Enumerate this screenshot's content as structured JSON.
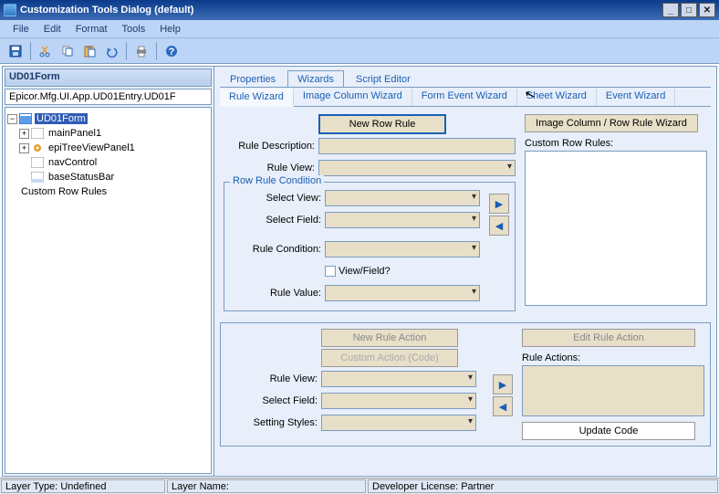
{
  "title": "Customization Tools Dialog (default)",
  "menu": {
    "file": "File",
    "edit": "Edit",
    "format": "Format",
    "tools": "Tools",
    "help": "Help"
  },
  "form_header": "UD01Form",
  "path": "Epicor.Mfg.UI.App.UD01Entry.UD01F",
  "tree": {
    "root": "UD01Form",
    "n1": "mainPanel1",
    "n2": "epiTreeViewPanel1",
    "n3": "navControl",
    "n4": "baseStatusBar",
    "n5": "Custom Row Rules"
  },
  "tabs_major": {
    "properties": "Properties",
    "wizards": "Wizards",
    "script": "Script Editor"
  },
  "tabs_sub": {
    "rule": "Rule Wizard",
    "image": "Image Column Wizard",
    "form": "Form Event Wizard",
    "sheet": "Sheet Wizard",
    "event": "Event Wizard"
  },
  "buttons": {
    "new_row_rule": "New Row Rule",
    "image_col": "Image Column / Row Rule Wizard",
    "new_rule_action": "New Rule Action",
    "custom_action": "Custom Action (Code)",
    "edit_rule_action": "Edit Rule Action",
    "update_code": "Update Code"
  },
  "labels": {
    "rule_desc": "Rule Description:",
    "rule_view": "Rule View:",
    "row_rule_cond": "Row Rule Condition",
    "select_view": "Select View:",
    "select_field": "Select Field:",
    "rule_condition": "Rule Condition:",
    "view_field": "View/Field?",
    "rule_value": "Rule Value:",
    "custom_row_rules": "Custom Row Rules:",
    "rule_actions": "Rule Actions:",
    "setting_styles": "Setting Styles:"
  },
  "status": {
    "layer_type": "Layer Type:  Undefined",
    "layer_name": "Layer Name:  ",
    "dev_license": "Developer License:  Partner"
  }
}
